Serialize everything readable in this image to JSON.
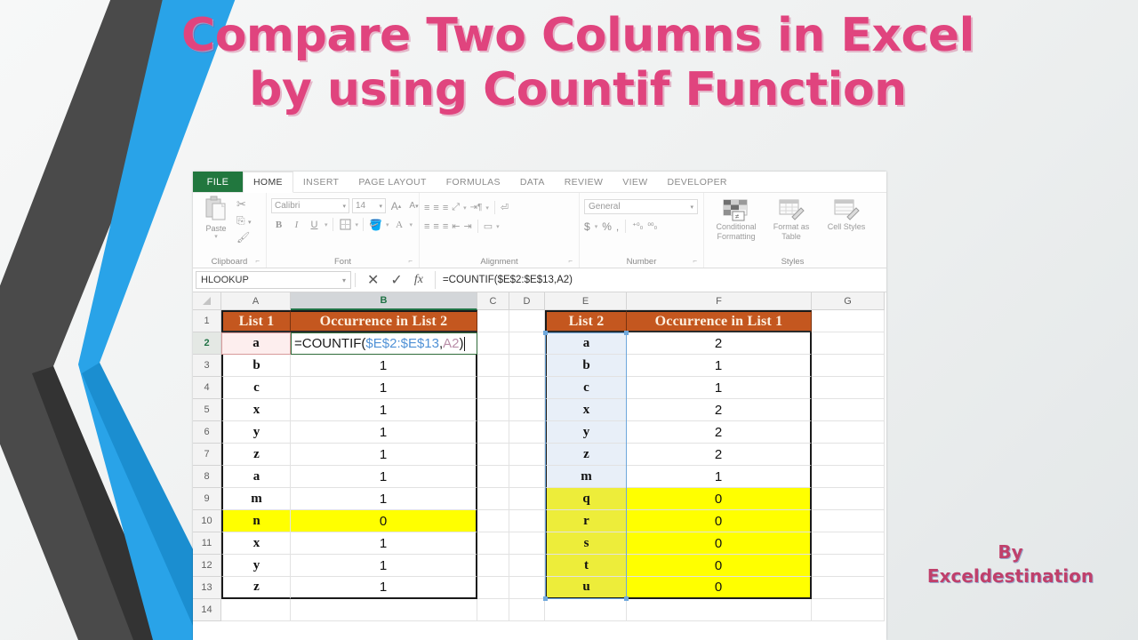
{
  "slide": {
    "title_line1": "Compare Two Columns in Excel",
    "title_line2": "by using Countif Function",
    "credit_line1": "By",
    "credit_line2": "Exceldestination",
    "title_color": "#e0447e",
    "credit_color": "#c0406b",
    "background_color": "#eef0f0",
    "chevron_colors": {
      "dark": "#4a4a4a",
      "blue": "#29a3e8"
    }
  },
  "excel": {
    "ribbon_tabs": [
      {
        "label": "FILE",
        "active": false,
        "style": "file"
      },
      {
        "label": "HOME",
        "active": true
      },
      {
        "label": "INSERT",
        "active": false
      },
      {
        "label": "PAGE LAYOUT",
        "active": false
      },
      {
        "label": "FORMULAS",
        "active": false
      },
      {
        "label": "DATA",
        "active": false
      },
      {
        "label": "REVIEW",
        "active": false
      },
      {
        "label": "VIEW",
        "active": false
      },
      {
        "label": "DEVELOPER",
        "active": false
      }
    ],
    "groups": {
      "clipboard": {
        "label": "Clipboard",
        "paste_label": "Paste"
      },
      "font": {
        "label": "Font",
        "font_name": "Calibri",
        "font_size": "14",
        "grow_label": "A",
        "shrink_label": "A",
        "bold_label": "B",
        "italic_label": "I",
        "underline_label": "U",
        "font_color_label": "A"
      },
      "alignment": {
        "label": "Alignment"
      },
      "number": {
        "label": "Number",
        "format": "General",
        "currency": "$",
        "percent": "%",
        "comma": ","
      },
      "styles": {
        "label": "Styles",
        "conditional_formatting": "Conditional Formatting",
        "format_as_table": "Format as Table",
        "cell_styles": "Cell Styles"
      }
    },
    "formula_bar": {
      "name_box": "HLOOKUP",
      "cancel_icon": "cancel-icon",
      "enter_icon": "check-icon",
      "function_icon": "fx-icon",
      "formula": "=COUNTIF($E$2:$E$13,A2)"
    },
    "grid": {
      "column_headers": [
        "A",
        "B",
        "C",
        "D",
        "E",
        "F",
        "G"
      ],
      "selected_column": "B",
      "selected_row": "2",
      "row_numbers": [
        "1",
        "2",
        "3",
        "4",
        "5",
        "6",
        "7",
        "8",
        "9",
        "10",
        "11",
        "12",
        "13",
        "14"
      ],
      "headers": {
        "A1": "List 1",
        "B1": "Occurrence in List 2",
        "E1": "List 2",
        "F1": "Occurrence in List 1"
      },
      "editing_cell": {
        "address": "B2",
        "prefix": "=COUNTIF(",
        "range_ref": "$E$2:$E$13",
        "comma": ",",
        "cell_ref": "A2",
        "suffix": ")"
      },
      "rows": [
        {
          "r": "2",
          "A": "a",
          "B": "",
          "E": "a",
          "F": "2",
          "A_hl": "edit",
          "B_hl": "edit",
          "E_hl": "blue",
          "F_hl": "none"
        },
        {
          "r": "3",
          "A": "b",
          "B": "1",
          "E": "b",
          "F": "1",
          "A_hl": "none",
          "B_hl": "none",
          "E_hl": "blue",
          "F_hl": "none"
        },
        {
          "r": "4",
          "A": "c",
          "B": "1",
          "E": "c",
          "F": "1",
          "A_hl": "none",
          "B_hl": "none",
          "E_hl": "blue",
          "F_hl": "none"
        },
        {
          "r": "5",
          "A": "x",
          "B": "1",
          "E": "x",
          "F": "2",
          "A_hl": "none",
          "B_hl": "none",
          "E_hl": "blue",
          "F_hl": "none"
        },
        {
          "r": "6",
          "A": "y",
          "B": "1",
          "E": "y",
          "F": "2",
          "A_hl": "none",
          "B_hl": "none",
          "E_hl": "blue",
          "F_hl": "none"
        },
        {
          "r": "7",
          "A": "z",
          "B": "1",
          "E": "z",
          "F": "2",
          "A_hl": "none",
          "B_hl": "none",
          "E_hl": "blue",
          "F_hl": "none"
        },
        {
          "r": "8",
          "A": "a",
          "B": "1",
          "E": "m",
          "F": "1",
          "A_hl": "none",
          "B_hl": "none",
          "E_hl": "blue",
          "F_hl": "none"
        },
        {
          "r": "9",
          "A": "m",
          "B": "1",
          "E": "q",
          "F": "0",
          "A_hl": "none",
          "B_hl": "none",
          "E_hl": "yellowsel",
          "F_hl": "yellow"
        },
        {
          "r": "10",
          "A": "n",
          "B": "0",
          "E": "r",
          "F": "0",
          "A_hl": "yellow",
          "B_hl": "yellow",
          "E_hl": "yellowsel",
          "F_hl": "yellow"
        },
        {
          "r": "11",
          "A": "x",
          "B": "1",
          "E": "s",
          "F": "0",
          "A_hl": "none",
          "B_hl": "none",
          "E_hl": "yellowsel",
          "F_hl": "yellow"
        },
        {
          "r": "12",
          "A": "y",
          "B": "1",
          "E": "t",
          "F": "0",
          "A_hl": "none",
          "B_hl": "none",
          "E_hl": "yellowsel",
          "F_hl": "yellow"
        },
        {
          "r": "13",
          "A": "z",
          "B": "1",
          "E": "u",
          "F": "0",
          "A_hl": "none",
          "B_hl": "none",
          "E_hl": "yellowsel",
          "F_hl": "yellow"
        }
      ]
    }
  }
}
